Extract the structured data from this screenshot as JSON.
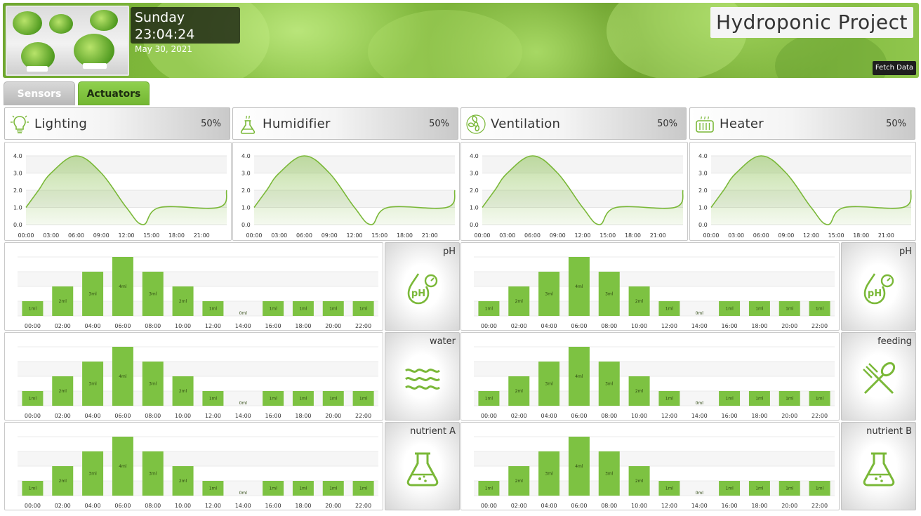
{
  "header": {
    "title": "Hydroponic Project",
    "clock_time": "Sunday 23:04:24",
    "clock_date": "May 30, 2021",
    "fetch_label": "Fetch Data"
  },
  "tabs": [
    {
      "label": "Sensors",
      "active": false
    },
    {
      "label": "Actuators",
      "active": true
    }
  ],
  "colors": {
    "accent": "#7ac142",
    "bar_fill": "#7dc242",
    "line": "#7ab838"
  },
  "actuators": [
    {
      "name": "Lighting",
      "value": "50%",
      "icon": "lightbulb-icon"
    },
    {
      "name": "Humidifier",
      "value": "50%",
      "icon": "flask-steam-icon"
    },
    {
      "name": "Ventilation",
      "value": "50%",
      "icon": "fan-icon"
    },
    {
      "name": "Heater",
      "value": "50%",
      "icon": "heater-icon"
    }
  ],
  "sensors": [
    {
      "label": "pH",
      "icon": "ph-drop-icon"
    },
    {
      "label": "pH",
      "icon": "ph-drop-icon"
    },
    {
      "label": "water",
      "icon": "water-waves-icon"
    },
    {
      "label": "feeding",
      "icon": "fork-spoon-icon"
    },
    {
      "label": "nutrient A",
      "icon": "flask-icon"
    },
    {
      "label": "nutrient B",
      "icon": "flask-icon"
    }
  ],
  "chart_data": [
    {
      "type": "area",
      "x": [
        "00:00",
        "03:00",
        "06:00",
        "09:00",
        "12:00",
        "15:00",
        "18:00",
        "21:00"
      ],
      "points": [
        [
          0,
          1.0
        ],
        [
          1.5,
          2.0
        ],
        [
          3,
          3.0
        ],
        [
          6,
          4.0
        ],
        [
          9,
          3.0
        ],
        [
          12,
          1.0
        ],
        [
          14,
          0.0
        ],
        [
          16,
          1.0
        ],
        [
          23,
          1.0
        ],
        [
          24,
          2.0
        ]
      ],
      "yticks": [
        "0.0",
        "1.0",
        "2.0",
        "3.0",
        "4.0"
      ],
      "ylim": [
        0,
        4
      ]
    },
    {
      "type": "bar",
      "categories": [
        "00:00",
        "02:00",
        "04:00",
        "06:00",
        "08:00",
        "10:00",
        "12:00",
        "14:00",
        "16:00",
        "18:00",
        "20:00",
        "22:00"
      ],
      "values": [
        1,
        2,
        3,
        4,
        3,
        2,
        1,
        0,
        1,
        1,
        1,
        1
      ],
      "labels": [
        "1ml",
        "2ml",
        "3ml",
        "4ml",
        "3ml",
        "2ml",
        "1ml",
        "0ml",
        "1ml",
        "1ml",
        "1ml",
        "1ml"
      ],
      "ylim": [
        0,
        4
      ]
    }
  ]
}
